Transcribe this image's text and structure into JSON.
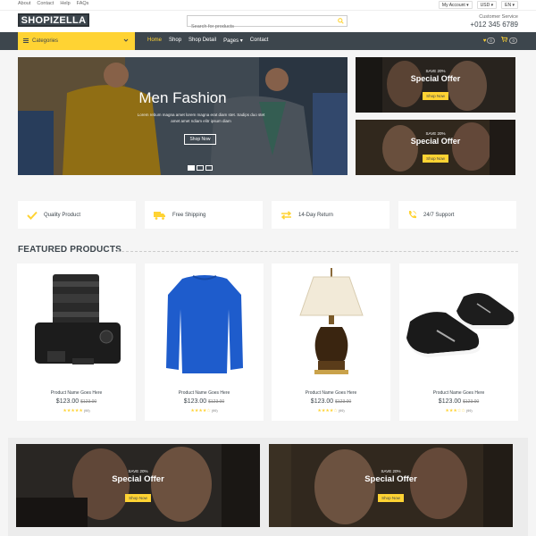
{
  "topbar": {
    "links": [
      "About",
      "Contact",
      "Help",
      "FAQs"
    ],
    "account": "My Account ▾",
    "currency": "USD ▾",
    "language": "EN ▾"
  },
  "header": {
    "logo": "SHOPIZELLA",
    "search_placeholder": "Search for products",
    "cs_label": "Customer Service",
    "cs_phone": "+012 345 6789"
  },
  "nav": {
    "categories_label": "Categories",
    "items": [
      "Home",
      "Shop",
      "Shop Detail",
      "Pages ▾",
      "Contact"
    ],
    "wishlist_count": "0",
    "cart_count": "0"
  },
  "hero": {
    "title": "Men Fashion",
    "text": "Lorem rebum magna amet lorem magna erat diam stet. Sadips duo stet amet amet ndiam elitr ipsum diam",
    "button": "Shop Now"
  },
  "offers": [
    {
      "save": "SAVE 20%",
      "title": "Special Offer",
      "button": "Shop Now"
    },
    {
      "save": "SAVE 20%",
      "title": "Special Offer",
      "button": "Shop Now"
    },
    {
      "save": "SAVE 20%",
      "title": "Special Offer",
      "button": "Shop Now"
    },
    {
      "save": "SAVE 20%",
      "title": "Special Offer",
      "button": "Shop Now"
    }
  ],
  "features": [
    "Quality Product",
    "Free Shipping",
    "14-Day Return",
    "24/7 Support"
  ],
  "featured_title": "FEATURED PRODUCTS",
  "products": [
    {
      "name": "Product Name Goes Here",
      "price": "$123.00",
      "old_price": "$123.00",
      "stars": "★★★★★",
      "rating": 5,
      "reviews": "(99)"
    },
    {
      "name": "Product Name Goes Here",
      "price": "$123.00",
      "old_price": "$123.00",
      "stars": "★★★★☆",
      "rating": 4.5,
      "reviews": "(99)"
    },
    {
      "name": "Product Name Goes Here",
      "price": "$123.00",
      "old_price": "$123.00",
      "stars": "★★★★☆",
      "rating": 3.5,
      "reviews": "(99)"
    },
    {
      "name": "Product Name Goes Here",
      "price": "$123.00",
      "old_price": "$123.00",
      "stars": "★★★☆☆",
      "rating": 3,
      "reviews": "(99)"
    }
  ],
  "colors": {
    "accent": "#ffd333",
    "dark": "#3d464d",
    "background": "#f5f5f5"
  }
}
